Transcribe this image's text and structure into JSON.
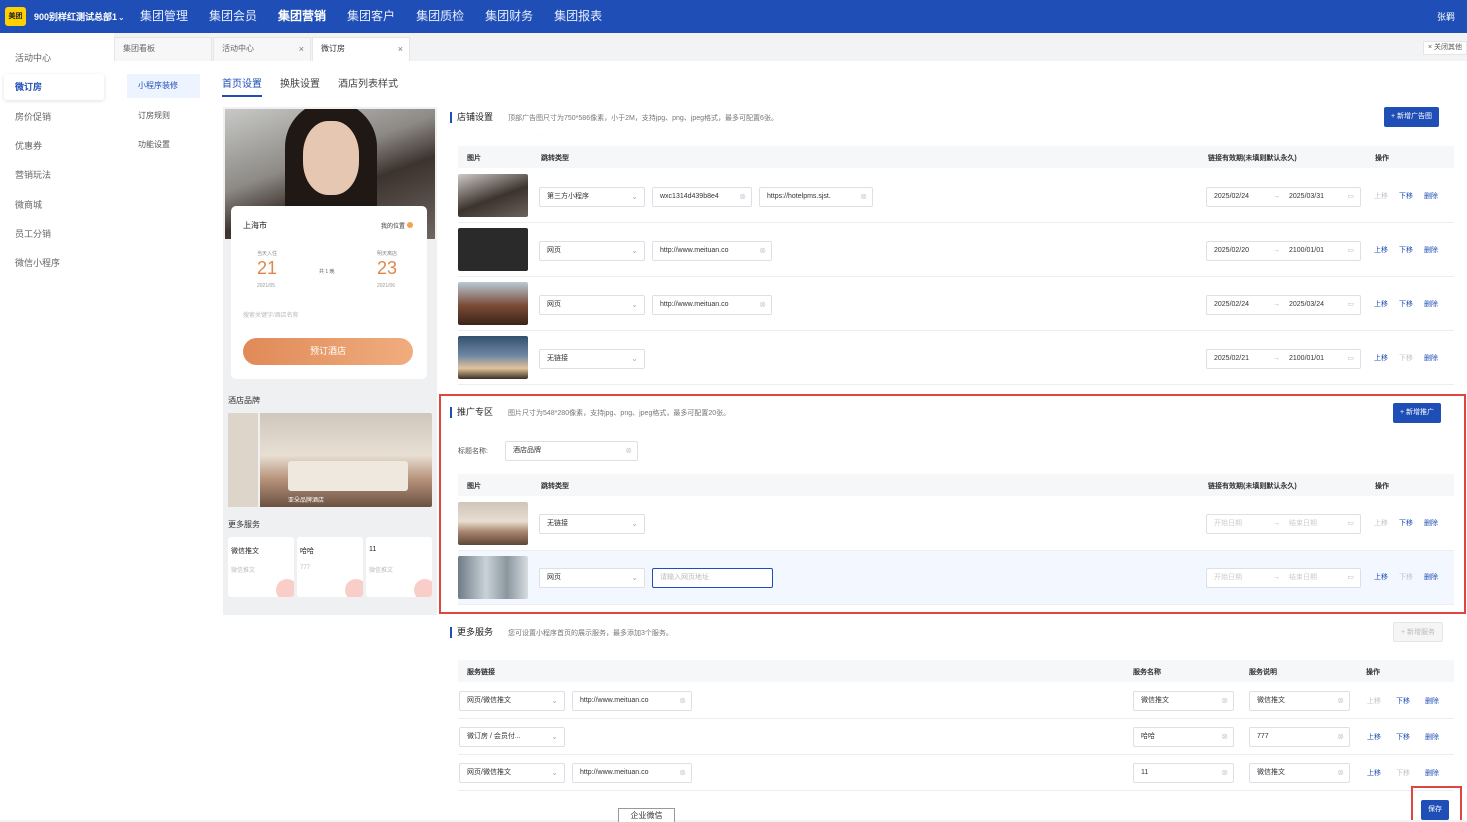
{
  "topbar": {
    "logo": "美团",
    "org": "900别样红测试总部1",
    "nav": [
      "集团管理",
      "集团会员",
      "集团营销",
      "集团客户",
      "集团质检",
      "集团财务",
      "集团报表"
    ],
    "active_nav": "集团营销",
    "user": "张羁",
    "color": "#1f4fb6"
  },
  "sidebar": {
    "items": [
      "活动中心",
      "微订房",
      "房价促销",
      "优惠券",
      "营销玩法",
      "微商城",
      "员工分销",
      "微信小程序"
    ],
    "active": "微订房"
  },
  "tabs": {
    "items": [
      {
        "label": "集团看板",
        "closable": false
      },
      {
        "label": "活动中心",
        "closable": true
      },
      {
        "label": "微订房",
        "closable": true
      }
    ],
    "close_all": "× 关闭其他"
  },
  "subnav": {
    "items": [
      "小程序装修",
      "订房规则",
      "功能设置"
    ],
    "active": "小程序装修"
  },
  "content_tabs": {
    "items": [
      "首页设置",
      "换肤设置",
      "酒店列表样式"
    ],
    "active": "首页设置"
  },
  "preview": {
    "city": "上海市",
    "my_location": "我的位置",
    "checkin_label": "当天入住",
    "checkin_day": "21",
    "checkin_month": "2021/05",
    "nights": "共 1 晚",
    "checkout_label": "明天离店",
    "checkout_day": "23",
    "checkout_month": "2021/06",
    "search_placeholder": "搜索关键字/酒店名称",
    "book_button": "预订酒店",
    "brand_title": "酒店品牌",
    "brand_caption": "亚朵品牌酒店",
    "more_title": "更多服务",
    "services": [
      {
        "title": "微信推文",
        "sub": "微信推文"
      },
      {
        "title": "哈哈",
        "sub": "777"
      },
      {
        "title": "11",
        "sub": "微信推文"
      }
    ]
  },
  "shop_settings": {
    "title": "店铺设置",
    "tip": "顶部广告图尺寸为750*586像素，小于2M，支持jpg、png、jpeg格式，最多可配置6张。",
    "add_button": "+ 新增广告图",
    "columns": [
      "图片",
      "跳转类型",
      "链接有效期(未填则默认永久)",
      "操作"
    ],
    "rows": [
      {
        "type": "第三方小程序",
        "appid": "wxc1314d439b8e4",
        "url": "https://hotelpms.sjst.",
        "start": "2025/02/24",
        "end": "2025/03/31",
        "up": "上移",
        "down": "下移",
        "del": "删除",
        "up_disabled": true,
        "down_disabled": false
      },
      {
        "type": "网页",
        "url": "http://www.meituan.co",
        "start": "2025/02/20",
        "end": "2100/01/01",
        "up": "上移",
        "down": "下移",
        "del": "删除",
        "up_disabled": false,
        "down_disabled": false
      },
      {
        "type": "网页",
        "url": "http://www.meituan.co",
        "start": "2025/02/24",
        "end": "2025/03/24",
        "up": "上移",
        "down": "下移",
        "del": "删除",
        "up_disabled": false,
        "down_disabled": false
      },
      {
        "type": "无链接",
        "start": "2025/02/21",
        "end": "2100/01/01",
        "up": "上移",
        "down": "下移",
        "del": "删除",
        "up_disabled": false,
        "down_disabled": true
      }
    ]
  },
  "promo": {
    "title": "推广专区",
    "tip": "图片尺寸为548*280像素，支持jpg、png、jpeg格式，最多可配置20张。",
    "add_button": "+ 新增推广",
    "label_name": "标题名称:",
    "label_value": "酒店品牌",
    "columns": [
      "图片",
      "跳转类型",
      "链接有效期(未填则默认永久)",
      "操作"
    ],
    "rows": [
      {
        "type": "无链接",
        "start_ph": "开始日期",
        "end_ph": "结束日期",
        "up": "上移",
        "down": "下移",
        "del": "删除"
      },
      {
        "type": "网页",
        "url_ph": "请输入网页地址",
        "start_ph": "开始日期",
        "end_ph": "结束日期",
        "up": "上移",
        "down": "下移",
        "del": "删除"
      }
    ]
  },
  "more_services": {
    "title": "更多服务",
    "tip": "您可设置小程序首页的展示服务，最多添加3个服务。",
    "add_button": "+ 新增服务",
    "columns": [
      "服务链接",
      "服务名称",
      "服务说明",
      "操作"
    ],
    "rows": [
      {
        "link_type": "网页/微信推文",
        "url": "http://www.meituan.co",
        "name": "微信推文",
        "desc": "微信推文",
        "up": "上移",
        "down": "下移",
        "del": "删除"
      },
      {
        "link_type": "微订房 / 会员付...",
        "url": "",
        "name": "哈哈",
        "desc": "777",
        "up": "上移",
        "down": "下移",
        "del": "删除"
      },
      {
        "link_type": "网页/微信推文",
        "url": "http://www.meituan.co",
        "name": "11",
        "desc": "微信推文",
        "up": "上移",
        "down": "下移",
        "del": "删除"
      }
    ]
  },
  "save_button": "保存",
  "floating_tab": "企业微信",
  "highlight_color": "#e0463f"
}
